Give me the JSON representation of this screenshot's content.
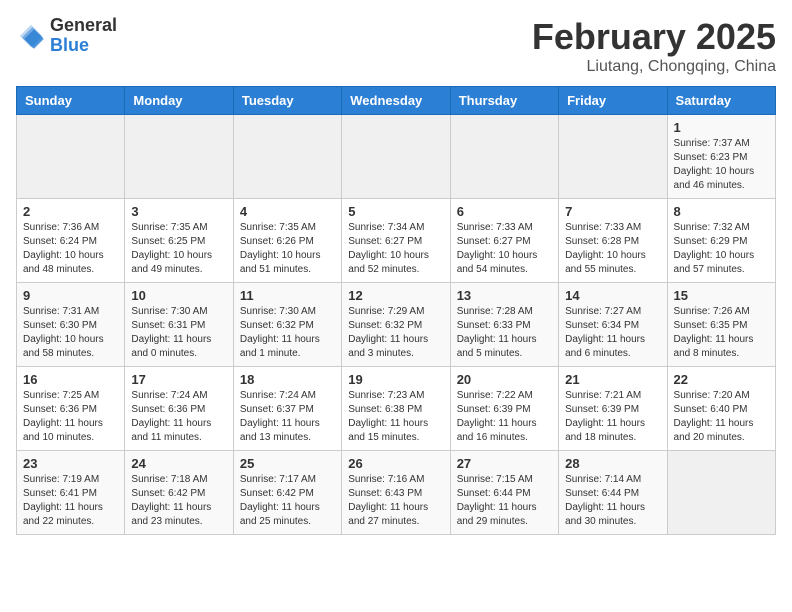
{
  "header": {
    "logo_general": "General",
    "logo_blue": "Blue",
    "title": "February 2025",
    "subtitle": "Liutang, Chongqing, China"
  },
  "calendar": {
    "weekdays": [
      "Sunday",
      "Monday",
      "Tuesday",
      "Wednesday",
      "Thursday",
      "Friday",
      "Saturday"
    ],
    "weeks": [
      [
        {
          "day": "",
          "info": ""
        },
        {
          "day": "",
          "info": ""
        },
        {
          "day": "",
          "info": ""
        },
        {
          "day": "",
          "info": ""
        },
        {
          "day": "",
          "info": ""
        },
        {
          "day": "",
          "info": ""
        },
        {
          "day": "1",
          "info": "Sunrise: 7:37 AM\nSunset: 6:23 PM\nDaylight: 10 hours and 46 minutes."
        }
      ],
      [
        {
          "day": "2",
          "info": "Sunrise: 7:36 AM\nSunset: 6:24 PM\nDaylight: 10 hours and 48 minutes."
        },
        {
          "day": "3",
          "info": "Sunrise: 7:35 AM\nSunset: 6:25 PM\nDaylight: 10 hours and 49 minutes."
        },
        {
          "day": "4",
          "info": "Sunrise: 7:35 AM\nSunset: 6:26 PM\nDaylight: 10 hours and 51 minutes."
        },
        {
          "day": "5",
          "info": "Sunrise: 7:34 AM\nSunset: 6:27 PM\nDaylight: 10 hours and 52 minutes."
        },
        {
          "day": "6",
          "info": "Sunrise: 7:33 AM\nSunset: 6:27 PM\nDaylight: 10 hours and 54 minutes."
        },
        {
          "day": "7",
          "info": "Sunrise: 7:33 AM\nSunset: 6:28 PM\nDaylight: 10 hours and 55 minutes."
        },
        {
          "day": "8",
          "info": "Sunrise: 7:32 AM\nSunset: 6:29 PM\nDaylight: 10 hours and 57 minutes."
        }
      ],
      [
        {
          "day": "9",
          "info": "Sunrise: 7:31 AM\nSunset: 6:30 PM\nDaylight: 10 hours and 58 minutes."
        },
        {
          "day": "10",
          "info": "Sunrise: 7:30 AM\nSunset: 6:31 PM\nDaylight: 11 hours and 0 minutes."
        },
        {
          "day": "11",
          "info": "Sunrise: 7:30 AM\nSunset: 6:32 PM\nDaylight: 11 hours and 1 minute."
        },
        {
          "day": "12",
          "info": "Sunrise: 7:29 AM\nSunset: 6:32 PM\nDaylight: 11 hours and 3 minutes."
        },
        {
          "day": "13",
          "info": "Sunrise: 7:28 AM\nSunset: 6:33 PM\nDaylight: 11 hours and 5 minutes."
        },
        {
          "day": "14",
          "info": "Sunrise: 7:27 AM\nSunset: 6:34 PM\nDaylight: 11 hours and 6 minutes."
        },
        {
          "day": "15",
          "info": "Sunrise: 7:26 AM\nSunset: 6:35 PM\nDaylight: 11 hours and 8 minutes."
        }
      ],
      [
        {
          "day": "16",
          "info": "Sunrise: 7:25 AM\nSunset: 6:36 PM\nDaylight: 11 hours and 10 minutes."
        },
        {
          "day": "17",
          "info": "Sunrise: 7:24 AM\nSunset: 6:36 PM\nDaylight: 11 hours and 11 minutes."
        },
        {
          "day": "18",
          "info": "Sunrise: 7:24 AM\nSunset: 6:37 PM\nDaylight: 11 hours and 13 minutes."
        },
        {
          "day": "19",
          "info": "Sunrise: 7:23 AM\nSunset: 6:38 PM\nDaylight: 11 hours and 15 minutes."
        },
        {
          "day": "20",
          "info": "Sunrise: 7:22 AM\nSunset: 6:39 PM\nDaylight: 11 hours and 16 minutes."
        },
        {
          "day": "21",
          "info": "Sunrise: 7:21 AM\nSunset: 6:39 PM\nDaylight: 11 hours and 18 minutes."
        },
        {
          "day": "22",
          "info": "Sunrise: 7:20 AM\nSunset: 6:40 PM\nDaylight: 11 hours and 20 minutes."
        }
      ],
      [
        {
          "day": "23",
          "info": "Sunrise: 7:19 AM\nSunset: 6:41 PM\nDaylight: 11 hours and 22 minutes."
        },
        {
          "day": "24",
          "info": "Sunrise: 7:18 AM\nSunset: 6:42 PM\nDaylight: 11 hours and 23 minutes."
        },
        {
          "day": "25",
          "info": "Sunrise: 7:17 AM\nSunset: 6:42 PM\nDaylight: 11 hours and 25 minutes."
        },
        {
          "day": "26",
          "info": "Sunrise: 7:16 AM\nSunset: 6:43 PM\nDaylight: 11 hours and 27 minutes."
        },
        {
          "day": "27",
          "info": "Sunrise: 7:15 AM\nSunset: 6:44 PM\nDaylight: 11 hours and 29 minutes."
        },
        {
          "day": "28",
          "info": "Sunrise: 7:14 AM\nSunset: 6:44 PM\nDaylight: 11 hours and 30 minutes."
        },
        {
          "day": "",
          "info": ""
        }
      ]
    ]
  }
}
